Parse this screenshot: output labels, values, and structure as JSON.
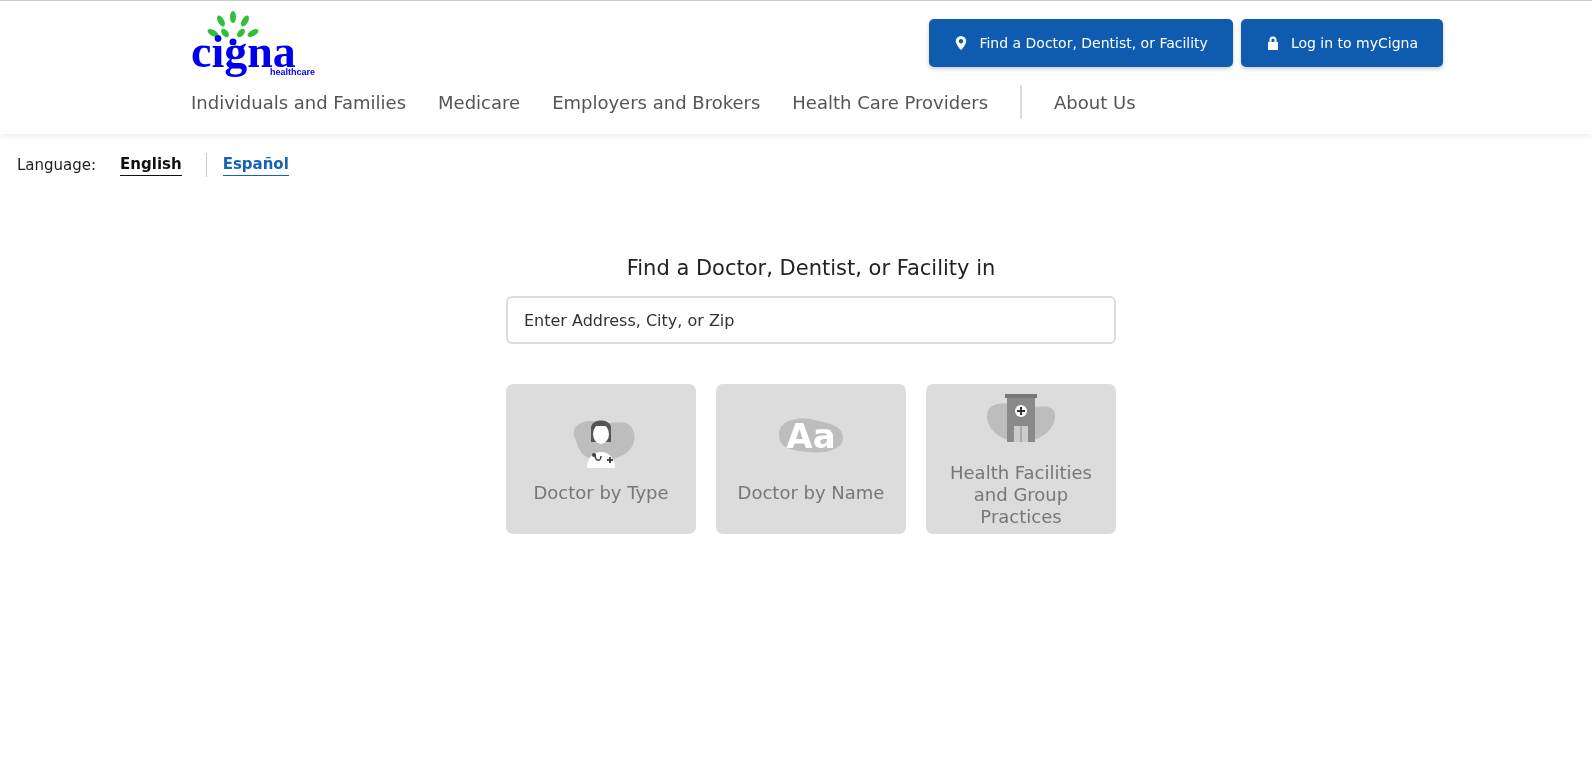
{
  "logo": {
    "wordmark": "cigna",
    "tagline": "healthcare"
  },
  "header_buttons": [
    {
      "label": "Find a Doctor, Dentist, or Facility",
      "kind": "pin"
    },
    {
      "label": "Log in to myCigna",
      "kind": "lock"
    }
  ],
  "nav": [
    {
      "label": "Individuals and Families",
      "separated": false
    },
    {
      "label": "Medicare",
      "separated": false
    },
    {
      "label": "Employers and Brokers",
      "separated": false
    },
    {
      "label": "Health Care Providers",
      "separated": false
    },
    {
      "label": "About Us",
      "separated": true
    }
  ],
  "language": {
    "label": "Language:",
    "options": [
      {
        "label": "English",
        "selected": true
      },
      {
        "label": "Español",
        "selected": false
      }
    ]
  },
  "search": {
    "heading": "Find a Doctor, Dentist, or Facility in",
    "placeholder": "Enter Address, City, or Zip"
  },
  "cards": [
    {
      "label": "Doctor by Type",
      "kind": "doctor"
    },
    {
      "label": "Doctor by Name",
      "kind": "letters",
      "icon_text": "Aa"
    },
    {
      "label": "Health Facilities and Group Practices",
      "kind": "building"
    }
  ]
}
